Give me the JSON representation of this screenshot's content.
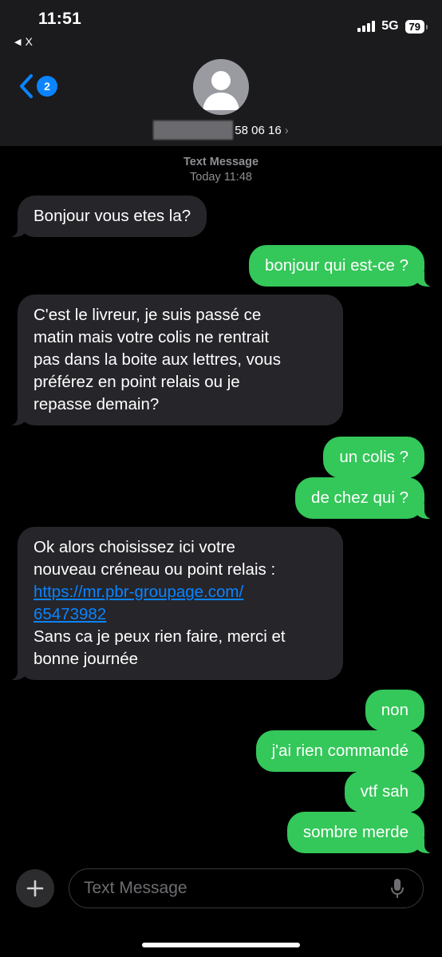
{
  "status": {
    "time": "11:51",
    "back_app": "X",
    "network": "5G",
    "battery": "79"
  },
  "header": {
    "back_badge": "2",
    "contact_number_visible": "58 06 16",
    "chevron": "›"
  },
  "thread": {
    "label": "Text Message",
    "timestamp": "Today 11:48"
  },
  "messages": [
    {
      "from": "them",
      "text": "Bonjour vous etes la?"
    },
    {
      "from": "me",
      "text": "bonjour qui est-ce ?"
    },
    {
      "from": "them",
      "lines": [
        "C'est le livreur, je suis passé ce",
        "matin mais votre colis ne rentrait",
        "pas dans la boite aux lettres, vous",
        "préférez en point relais ou je",
        "repasse demain?"
      ]
    },
    {
      "from": "me",
      "text": "un colis ?"
    },
    {
      "from": "me",
      "text": "de chez qui ?"
    },
    {
      "from": "them",
      "intro": [
        "Ok alors choisissez ici votre",
        "nouveau créneau ou point relais :"
      ],
      "link": [
        "https://mr.pbr-groupage.com/",
        "65473982"
      ],
      "outro": [
        "Sans ca je peux rien faire, merci et",
        "bonne journée"
      ]
    },
    {
      "from": "me",
      "text": "non"
    },
    {
      "from": "me",
      "text": "j'ai rien commandé"
    },
    {
      "from": "me",
      "text": "vtf sah"
    },
    {
      "from": "me",
      "text": "sombre merde"
    }
  ],
  "composer": {
    "placeholder": "Text Message"
  },
  "icons": {
    "back": "chevron-left-icon",
    "avatar": "person-icon",
    "plus": "plus-icon",
    "mic": "microphone-icon"
  },
  "colors": {
    "incoming_bubble": "#26252a",
    "outgoing_bubble": "#34c759",
    "accent": "#0a84ff"
  }
}
